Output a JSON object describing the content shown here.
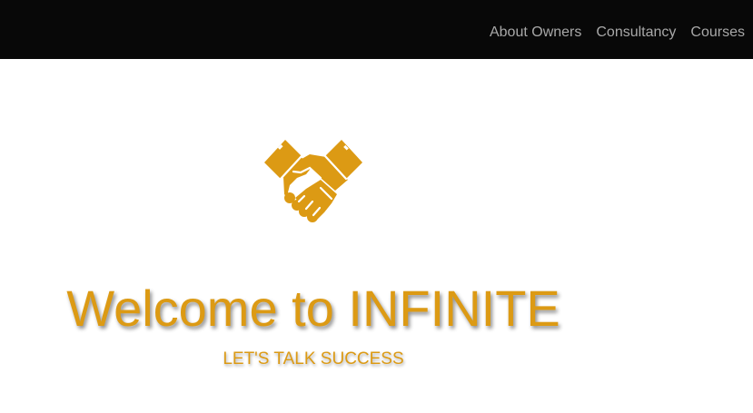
{
  "nav": {
    "items": [
      {
        "label": "About Owners"
      },
      {
        "label": "Consultancy"
      },
      {
        "label": "Courses"
      }
    ]
  },
  "hero": {
    "icon": "handshake-icon",
    "title": "Welcome to INFINITE",
    "subtitle": "LET'S TALK SUCCESS"
  },
  "colors": {
    "navbar_bg": "#080808",
    "nav_text": "#a8a8a8",
    "accent": "#dc9a14",
    "page_bg": "#ffffff"
  }
}
